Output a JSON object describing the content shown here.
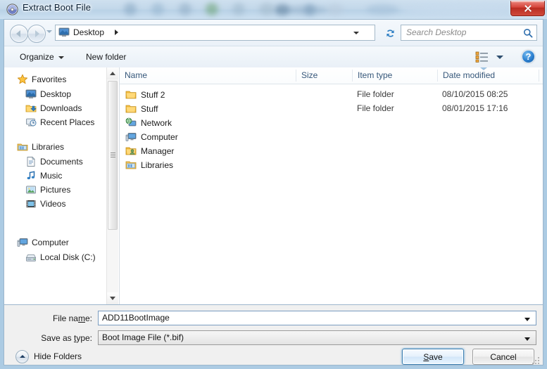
{
  "window": {
    "title": "Extract Boot File",
    "app_icon": "disc-icon",
    "close_label": "Close"
  },
  "navbar": {
    "back_label": "Back",
    "forward_label": "Forward",
    "history_label": "Recent pages",
    "address": {
      "icon": "desktop-icon",
      "crumb": "Desktop"
    },
    "refresh_label": "Refresh",
    "search": {
      "placeholder": "Search Desktop",
      "value": ""
    }
  },
  "commandbar": {
    "organize": "Organize",
    "new_folder": "New folder",
    "view_label": "Change your view",
    "help_label": "?"
  },
  "sidebar": {
    "groups": [
      {
        "header": "Favorites",
        "icon": "star-icon",
        "items": [
          {
            "label": "Desktop",
            "icon": "desktop-icon"
          },
          {
            "label": "Downloads",
            "icon": "downloads-icon"
          },
          {
            "label": "Recent Places",
            "icon": "recent-places-icon"
          }
        ]
      },
      {
        "header": "Libraries",
        "icon": "libraries-icon",
        "items": [
          {
            "label": "Documents",
            "icon": "documents-icon"
          },
          {
            "label": "Music",
            "icon": "music-icon"
          },
          {
            "label": "Pictures",
            "icon": "pictures-icon"
          },
          {
            "label": "Videos",
            "icon": "videos-icon"
          }
        ]
      },
      {
        "header": "Computer",
        "icon": "computer-icon",
        "items": [
          {
            "label": "Local Disk (C:)",
            "icon": "harddisk-icon"
          }
        ]
      }
    ]
  },
  "filelist": {
    "columns": [
      {
        "label": "Name",
        "sorted": false
      },
      {
        "label": "Size",
        "sorted": false
      },
      {
        "label": "Item type",
        "sorted": false
      },
      {
        "label": "Date modified",
        "sorted": true
      }
    ],
    "rows": [
      {
        "name": "Stuff 2",
        "icon": "folder-icon",
        "size": "",
        "type": "File folder",
        "date": "08/10/2015 08:25"
      },
      {
        "name": "Stuff",
        "icon": "folder-icon",
        "size": "",
        "type": "File folder",
        "date": "08/01/2015 17:16"
      },
      {
        "name": "Network",
        "icon": "network-icon",
        "size": "",
        "type": "",
        "date": ""
      },
      {
        "name": "Computer",
        "icon": "computer-icon",
        "size": "",
        "type": "",
        "date": ""
      },
      {
        "name": "Manager",
        "icon": "user-folder-icon",
        "size": "",
        "type": "",
        "date": ""
      },
      {
        "name": "Libraries",
        "icon": "libraries-icon",
        "size": "",
        "type": "",
        "date": ""
      }
    ]
  },
  "form": {
    "filename_label": "File name:",
    "filename_value": "ADD11BootImage",
    "savetype_label": "Save as type:",
    "savetype_value": "Boot Image File (*.bif)"
  },
  "footer": {
    "hide_folders": "Hide Folders",
    "save_label": "Save",
    "cancel_label": "Cancel"
  },
  "colors": {
    "accent": "#3c7fb1",
    "close": "#b92d22",
    "header_text": "#36577a",
    "folder": "#f6c559"
  }
}
